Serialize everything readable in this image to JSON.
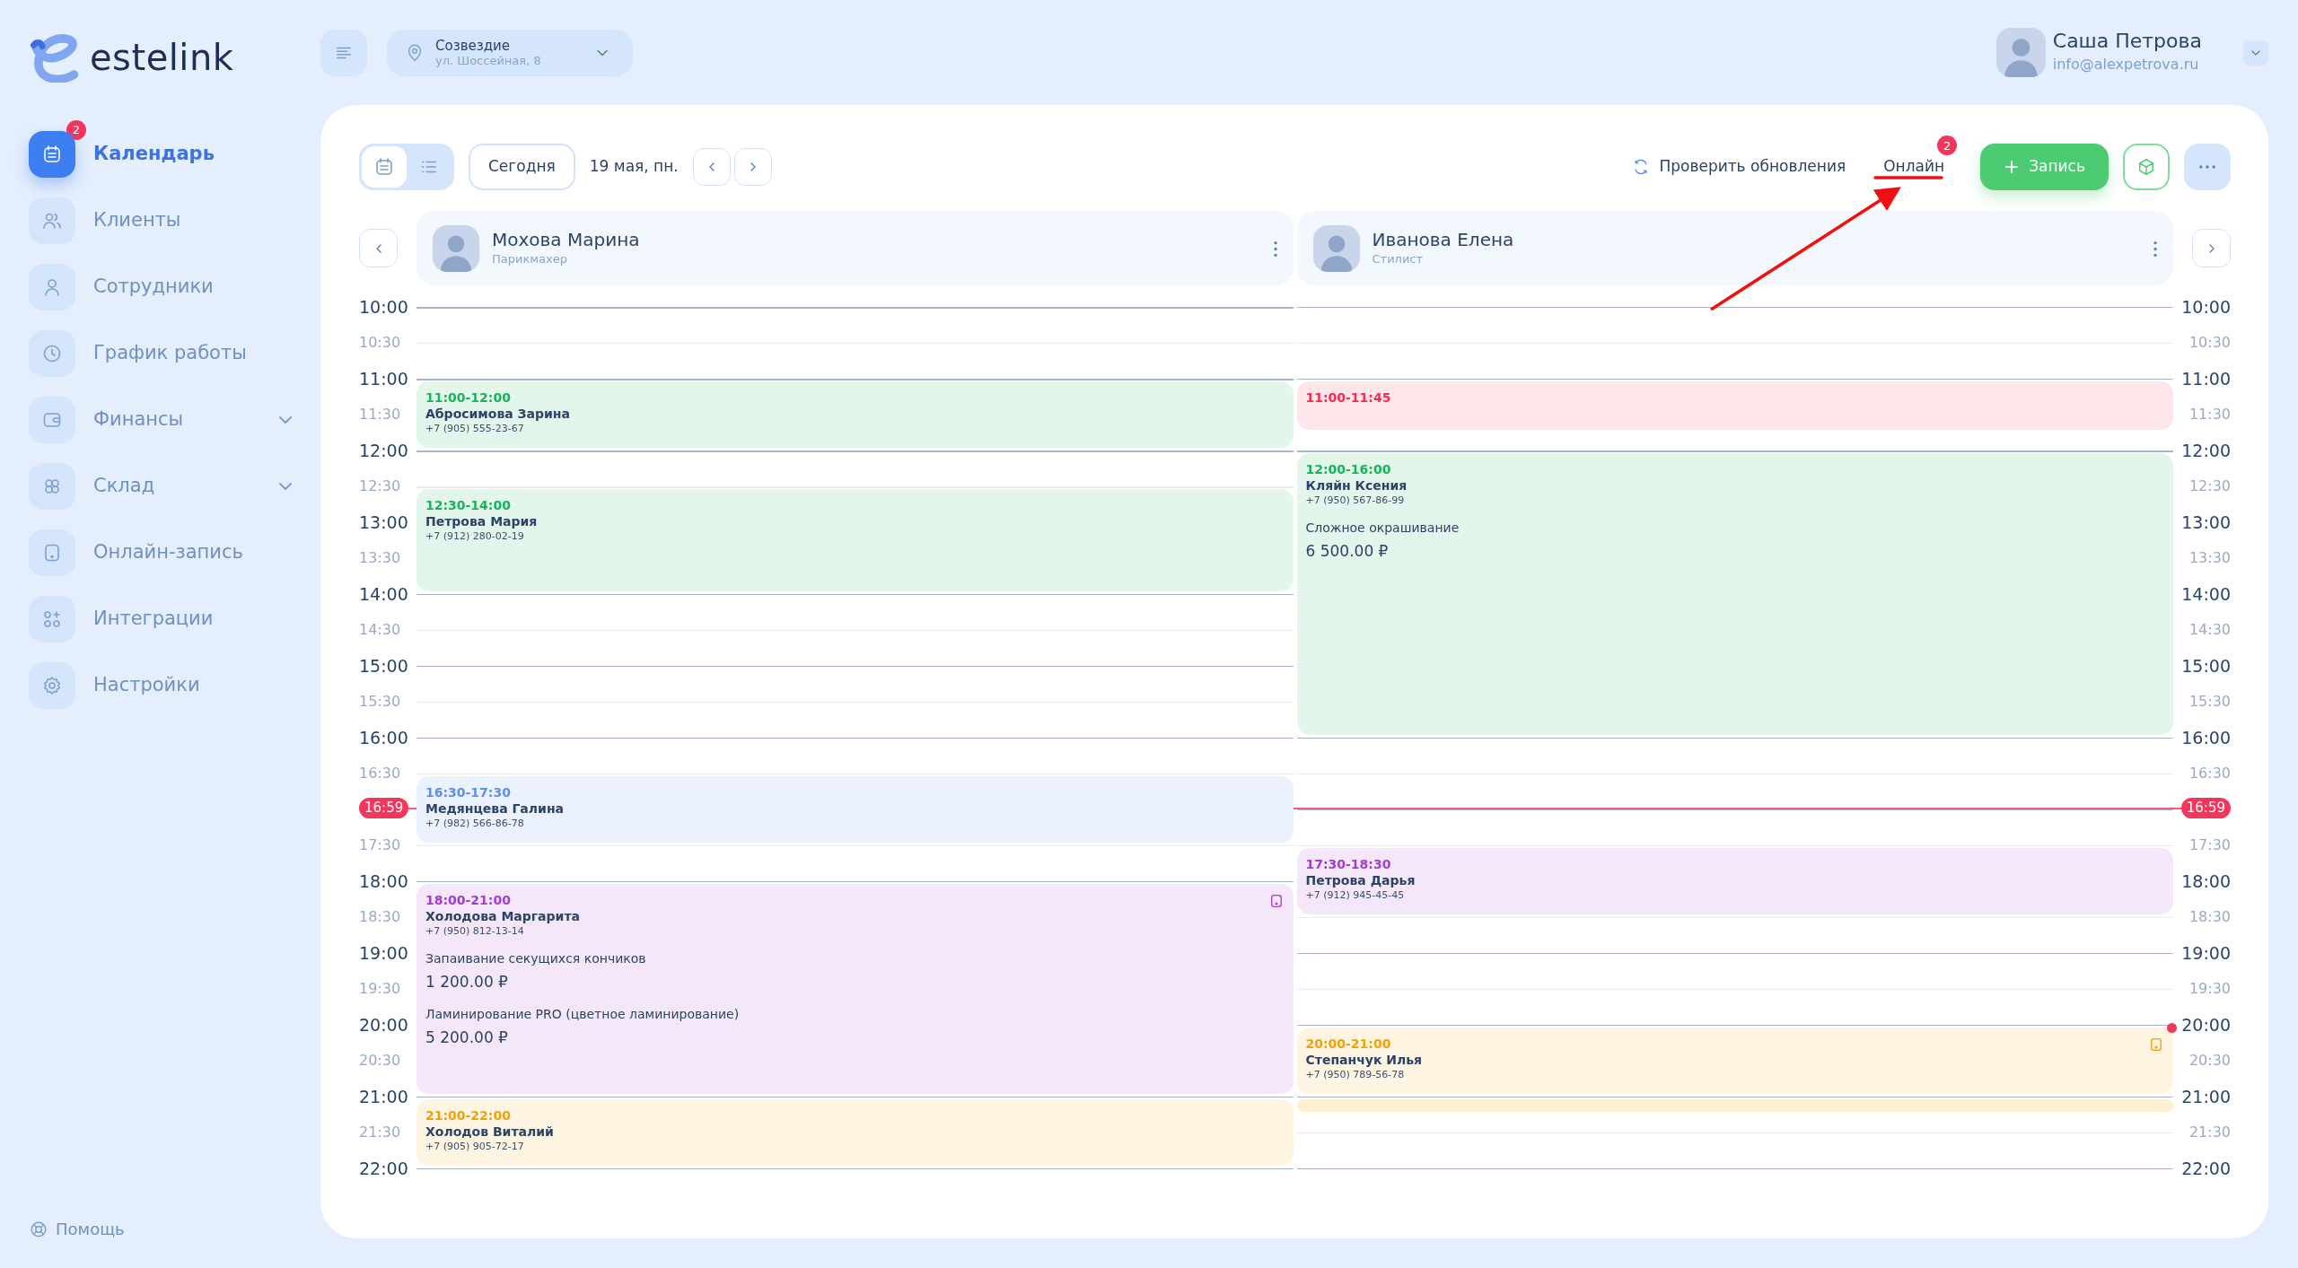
{
  "logo": {
    "text": "estelink"
  },
  "sidebar": {
    "items": [
      {
        "label": "Календарь",
        "selected": true,
        "badge": "2",
        "expandable": false
      },
      {
        "label": "Клиенты",
        "selected": false,
        "expandable": false
      },
      {
        "label": "Сотрудники",
        "selected": false,
        "expandable": false
      },
      {
        "label": "График работы",
        "selected": false,
        "expandable": false
      },
      {
        "label": "Финансы",
        "selected": false,
        "expandable": true
      },
      {
        "label": "Склад",
        "selected": false,
        "expandable": true
      },
      {
        "label": "Онлайн-запись",
        "selected": false,
        "expandable": false
      },
      {
        "label": "Интеграции",
        "selected": false,
        "expandable": false
      },
      {
        "label": "Настройки",
        "selected": false,
        "expandable": false
      }
    ],
    "help": "Помощь"
  },
  "header": {
    "location": {
      "name": "Созвездие",
      "address": "ул. Шоссейная, 8"
    },
    "user": {
      "name": "Саша Петрова",
      "email": "info@alexpetrova.ru"
    }
  },
  "toolbar": {
    "view_modes": [
      {
        "kind": "calendar",
        "selected": true
      },
      {
        "kind": "list",
        "selected": false
      }
    ],
    "today": "Сегодня",
    "date": "19 мая, пн.",
    "refresh": "Проверить обновления",
    "online": {
      "label": "Онлайн",
      "badge": "2"
    },
    "add": "Запись"
  },
  "time_axis": {
    "left": [
      "10:00",
      "10:30",
      "11:00",
      "11:30",
      "12:00",
      "12:30",
      "13:00",
      "13:30",
      "14:00",
      "14:30",
      "15:00",
      "15:30",
      "16:00",
      "16:30",
      "17:30",
      "18:00",
      "18:30",
      "19:00",
      "19:30",
      "20:00",
      "20:30",
      "21:00",
      "21:30",
      "22:00"
    ],
    "right": [
      "10:00",
      "10:30",
      "11:00",
      "11:30",
      "12:00",
      "12:30",
      "13:00",
      "13:30",
      "14:00",
      "14:30",
      "15:00",
      "15:30",
      "16:00",
      "16:30",
      "17:30",
      "18:00",
      "18:30",
      "19:00",
      "19:30",
      "20:00",
      "20:30",
      "21:00",
      "21:30",
      "22:00"
    ]
  },
  "now_badges": [
    "16:59",
    "16:59"
  ],
  "columns": [
    {
      "staff": {
        "name": "Мохова Марина",
        "role": "Парикмахер"
      },
      "events": [
        {
          "kind": "appointment",
          "time": "11:00-12:00",
          "client": "Абросимова Зарина",
          "phone": "+7 (905) 555-23-67",
          "color": "#19b35a",
          "device": false,
          "unread": false
        },
        {
          "kind": "appointment",
          "time": "12:30-14:00",
          "client": "Петрова Мария",
          "phone": "+7 (912) 280-02-19",
          "color": "#19b35a",
          "device": false,
          "unread": false
        },
        {
          "kind": "appointment",
          "time": "16:30-17:30",
          "client": "Медянцева Галина",
          "phone": "+7 (982) 566-86-78",
          "color": "#5a8ff0",
          "device": false,
          "unread": false
        },
        {
          "kind": "appointment",
          "time": "18:00-21:00",
          "client": "Холодова Маргарита",
          "phone": "+7 (950) 812-13-14",
          "color": "#a43bd1",
          "device": true,
          "unread": false,
          "services": [
            {
              "name": "Запаивание секущихся кончиков",
              "price": "1 200.00 ₽"
            },
            {
              "name": "Ламинирование PRO (цветное ламинирование)",
              "price": "5 200.00 ₽"
            }
          ]
        },
        {
          "kind": "appointment",
          "time": "21:00-22:00",
          "client": "Холодов Виталий",
          "phone": "+7 (905) 905-72-17",
          "color": "#eea20a",
          "device": false,
          "unread": false
        }
      ]
    },
    {
      "staff": {
        "name": "Иванова Елена",
        "role": "Стилист"
      },
      "events": [
        {
          "kind": "appointment",
          "time": "11:00-11:45",
          "color": "#f02d4f",
          "device": false,
          "unread": false
        },
        {
          "kind": "appointment",
          "time": "12:00-16:00",
          "client": "Кляйн Ксения",
          "phone": "+7 (950) 567-86-99",
          "color": "#19b35a",
          "device": false,
          "unread": false,
          "services": [
            {
              "name": "Сложное окрашивание",
              "price": "6 500.00 ₽"
            }
          ]
        },
        {
          "kind": "appointment",
          "time": "17:30-18:30",
          "client": "Петрова Дарья",
          "phone": "+7 (912) 945-45-45",
          "color": "#a43bd1",
          "device": false,
          "unread": false
        },
        {
          "kind": "appointment",
          "time": "20:00-21:00",
          "client": "Степанчук Илья",
          "phone": "+7 (950) 789-56-78",
          "color": "#eea20a",
          "device": true,
          "unread": true
        },
        {
          "kind": "blank",
          "color": "#fff1cf"
        }
      ]
    }
  ]
}
